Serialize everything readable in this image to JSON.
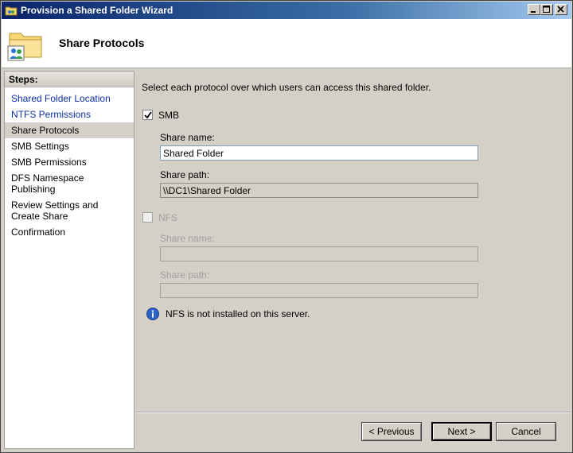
{
  "window": {
    "title": "Provision a Shared Folder Wizard"
  },
  "header": {
    "title": "Share Protocols"
  },
  "sidebar": {
    "heading": "Steps:",
    "items": [
      {
        "label": "Shared Folder Location"
      },
      {
        "label": "NTFS Permissions"
      },
      {
        "label": "Share Protocols"
      },
      {
        "label": "SMB Settings"
      },
      {
        "label": "SMB Permissions"
      },
      {
        "label": "DFS Namespace Publishing"
      },
      {
        "label": "Review Settings and Create Share"
      },
      {
        "label": "Confirmation"
      }
    ],
    "current_index": 2
  },
  "main": {
    "instruction": "Select each protocol over which users can access this shared folder.",
    "smb": {
      "checkbox_label": "SMB",
      "checked": true,
      "share_name_label": "Share name:",
      "share_name_value": "Shared Folder",
      "share_path_label": "Share path:",
      "share_path_value": "\\\\DC1\\Shared Folder"
    },
    "nfs": {
      "checkbox_label": "NFS",
      "checked": false,
      "enabled": false,
      "share_name_label": "Share name:",
      "share_name_value": "",
      "share_path_label": "Share path:",
      "share_path_value": ""
    },
    "info_message": "NFS is not installed on this server."
  },
  "buttons": {
    "previous": "< Previous",
    "next": "Next >",
    "cancel": "Cancel"
  },
  "icons": {
    "title": "shared-folder-wizard-icon",
    "header": "folder-share-icon",
    "info": "info-icon"
  },
  "colors": {
    "title_bar_start": "#0a246a",
    "link": "#0b2fa8",
    "face": "#d4d0c8"
  }
}
